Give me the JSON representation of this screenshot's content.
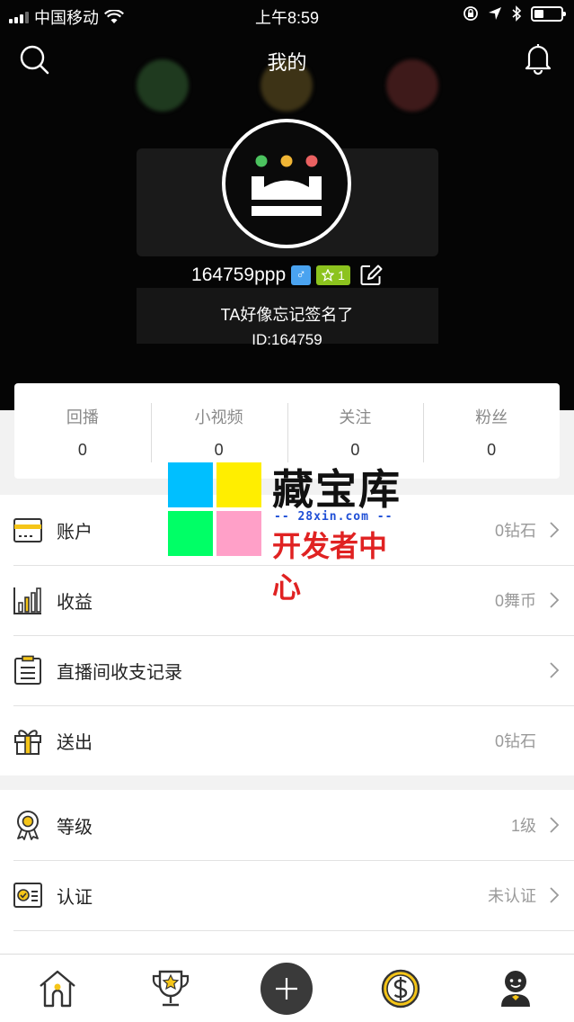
{
  "status_bar": {
    "carrier": "中国移动",
    "time": "上午8:59"
  },
  "header": {
    "title": "我的"
  },
  "profile": {
    "username": "164759ppp",
    "gender_symbol": "♂",
    "level": "1",
    "signature": "TA好像忘记签名了",
    "user_id": "ID:164759"
  },
  "stats": [
    {
      "label": "回播",
      "value": "0"
    },
    {
      "label": "小视频",
      "value": "0"
    },
    {
      "label": "关注",
      "value": "0"
    },
    {
      "label": "粉丝",
      "value": "0"
    }
  ],
  "menu_group1": [
    {
      "label": "账户",
      "value": "0钻石",
      "icon": "card-icon",
      "arrow": true
    },
    {
      "label": "收益",
      "value": "0舞币",
      "icon": "bar-chart-icon",
      "arrow": true
    },
    {
      "label": "直播间收支记录",
      "value": "",
      "icon": "clipboard-icon",
      "arrow": true
    },
    {
      "label": "送出",
      "value": "0钻石",
      "icon": "gift-icon",
      "arrow": false
    }
  ],
  "menu_group2": [
    {
      "label": "等级",
      "value": "1级",
      "icon": "medal-icon",
      "arrow": true
    },
    {
      "label": "认证",
      "value": "未认证",
      "icon": "id-card-icon",
      "arrow": true
    }
  ],
  "watermark": {
    "title": "藏宝库",
    "url": "-- 28xin.com --",
    "subtitle": "开发者中心"
  },
  "tabbar": [
    {
      "name": "home-tab",
      "icon": "home-icon"
    },
    {
      "name": "ranking-tab",
      "icon": "trophy-icon"
    },
    {
      "name": "publish-tab",
      "icon": "plus-icon"
    },
    {
      "name": "earnings-tab",
      "icon": "dollar-coin-icon"
    },
    {
      "name": "profile-tab",
      "icon": "user-icon"
    }
  ],
  "colors": {
    "accent_yellow": "#f5c518",
    "header_bg": "#050505",
    "gender_blue": "#4aa3f0",
    "level_green": "#8cc31e"
  }
}
